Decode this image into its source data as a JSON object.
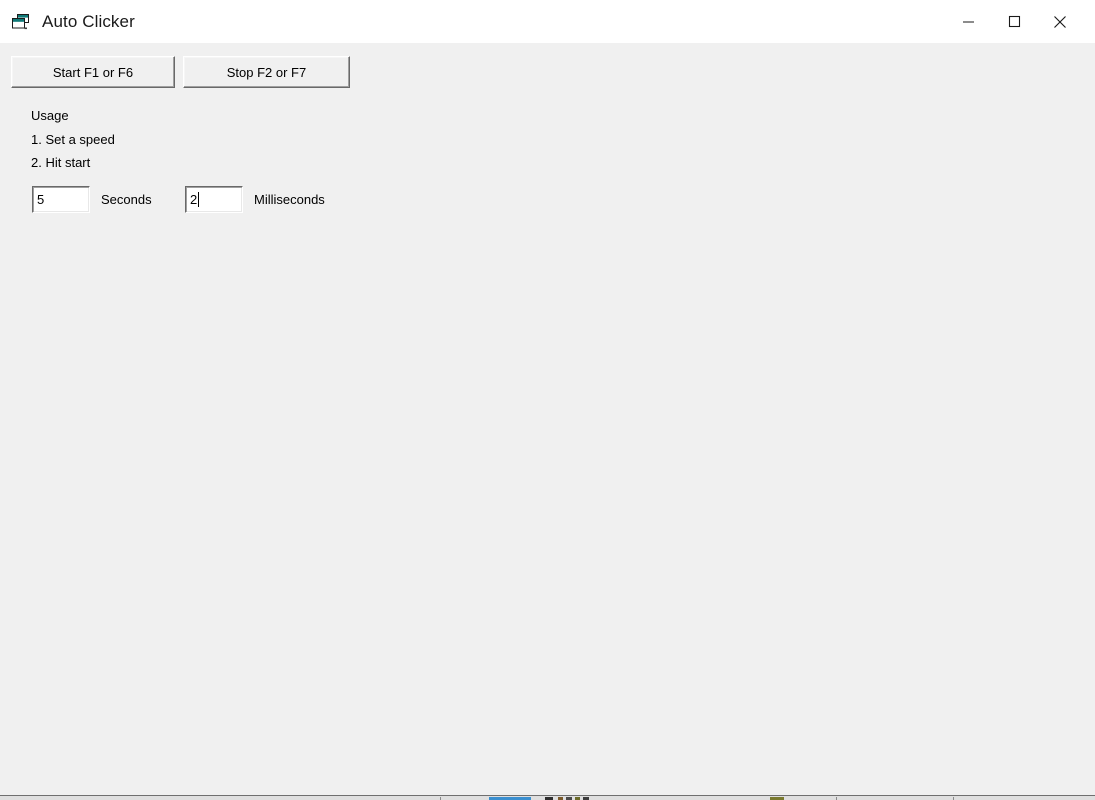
{
  "window": {
    "title": "Auto Clicker",
    "icon": "app-form-icon",
    "background_color": "#f0f0f0",
    "titlebar_color": "#ffffff",
    "controls": {
      "minimize": "minimize-icon",
      "maximize": "maximize-icon",
      "close": "close-icon"
    }
  },
  "toolbar": {
    "start_label": "Start F1 or F6",
    "stop_label": "Stop F2 or F7"
  },
  "usage": {
    "heading": "Usage",
    "steps": [
      "1. Set a speed",
      "2. Hit start"
    ]
  },
  "speed": {
    "seconds": {
      "value": "5",
      "label": "Seconds"
    },
    "milliseconds": {
      "value": "2",
      "label": "Milliseconds"
    }
  }
}
